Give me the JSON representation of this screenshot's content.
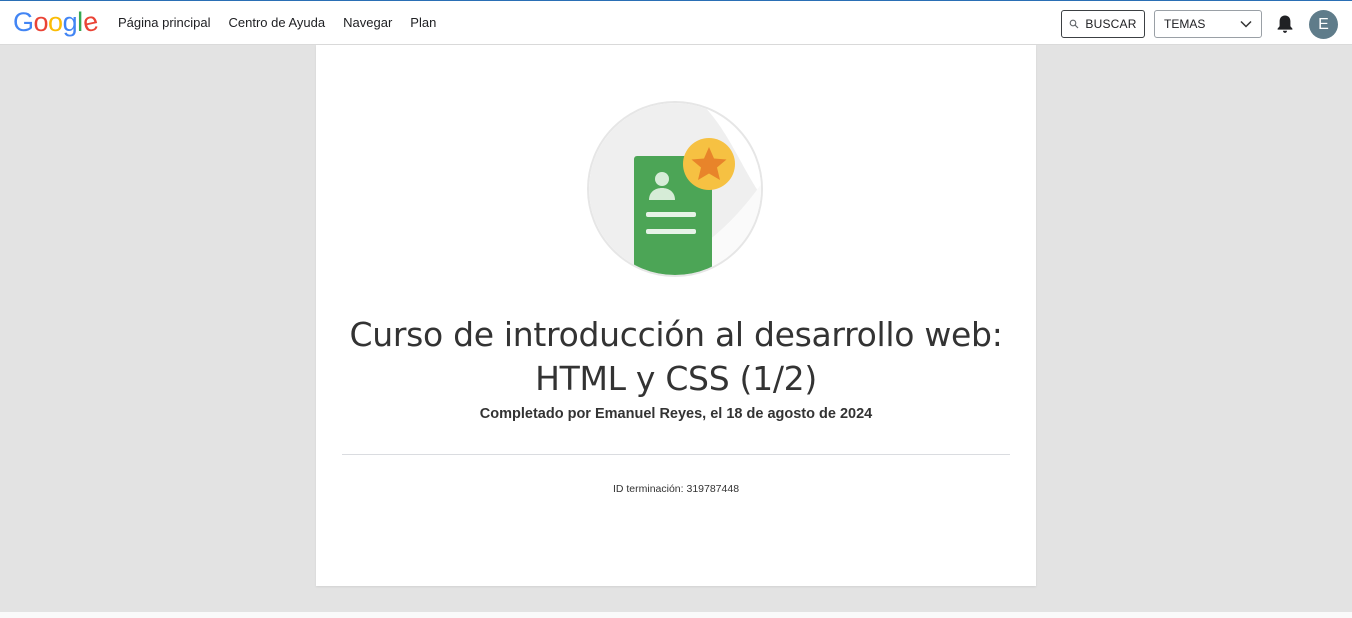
{
  "header": {
    "logo_letters": [
      {
        "char": "G",
        "color": "#4285F4"
      },
      {
        "char": "o",
        "color": "#EA4335"
      },
      {
        "char": "o",
        "color": "#FBBC05"
      },
      {
        "char": "g",
        "color": "#4285F4"
      },
      {
        "char": "l",
        "color": "#34A853"
      },
      {
        "char": "e",
        "color": "#EA4335"
      }
    ],
    "nav": [
      {
        "label": "Página principal"
      },
      {
        "label": "Centro de Ayuda"
      },
      {
        "label": "Navegar"
      },
      {
        "label": "Plan"
      }
    ],
    "search_label": "BUSCAR",
    "topics_label": "TEMAS",
    "avatar_letter": "E",
    "icons": {
      "search": "search-icon",
      "bell": "bell-icon",
      "chevron": "chevron-down-icon"
    }
  },
  "certificate": {
    "title": "Curso de introducción al desarrollo web: HTML y CSS (1/2)",
    "completed_text": "Completado por Emanuel Reyes, el 18 de agosto de 2024",
    "id_text": "ID terminación: 319787448",
    "badge_colors": {
      "card": "#4CA556",
      "star_bg": "#F6C142",
      "star": "#E8842A",
      "circle": "#ececec"
    }
  }
}
